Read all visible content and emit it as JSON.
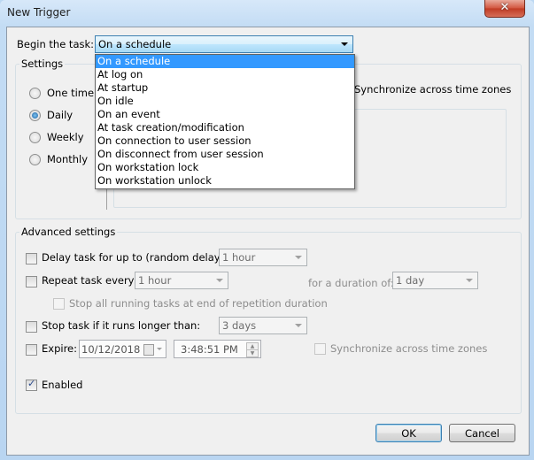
{
  "window": {
    "title": "New Trigger",
    "close_glyph": "✕"
  },
  "begin": {
    "label": "Begin the task:",
    "selected": "On a schedule",
    "options": [
      "On a schedule",
      "At log on",
      "At startup",
      "On idle",
      "On an event",
      "At task creation/modification",
      "On connection to user session",
      "On disconnect from user session",
      "On workstation lock",
      "On workstation unlock"
    ]
  },
  "settings": {
    "title": "Settings",
    "radios": [
      {
        "label": "One time",
        "checked": false
      },
      {
        "label": "Daily",
        "checked": true
      },
      {
        "label": "Weekly",
        "checked": false
      },
      {
        "label": "Monthly",
        "checked": false
      }
    ],
    "sync_label": "Synchronize across time zones"
  },
  "advanced": {
    "title": "Advanced settings",
    "delay": {
      "label": "Delay task for up to (random delay):",
      "value": "1 hour",
      "checked": false
    },
    "repeat": {
      "label": "Repeat task every:",
      "value": "1 hour",
      "checked": false,
      "duration_label": "for a duration of:",
      "duration_value": "1 day"
    },
    "stop_all": {
      "label": "Stop all running tasks at end of repetition duration",
      "checked": false
    },
    "stop_longer": {
      "label": "Stop task if it runs longer than:",
      "value": "3 days",
      "checked": false
    },
    "expire": {
      "label": "Expire:",
      "date": "10/12/2018",
      "time": "3:48:51 PM",
      "checked": false,
      "sync_label": "Synchronize across time zones"
    },
    "enabled": {
      "label": "Enabled",
      "checked": true
    }
  },
  "buttons": {
    "ok": "OK",
    "cancel": "Cancel"
  }
}
